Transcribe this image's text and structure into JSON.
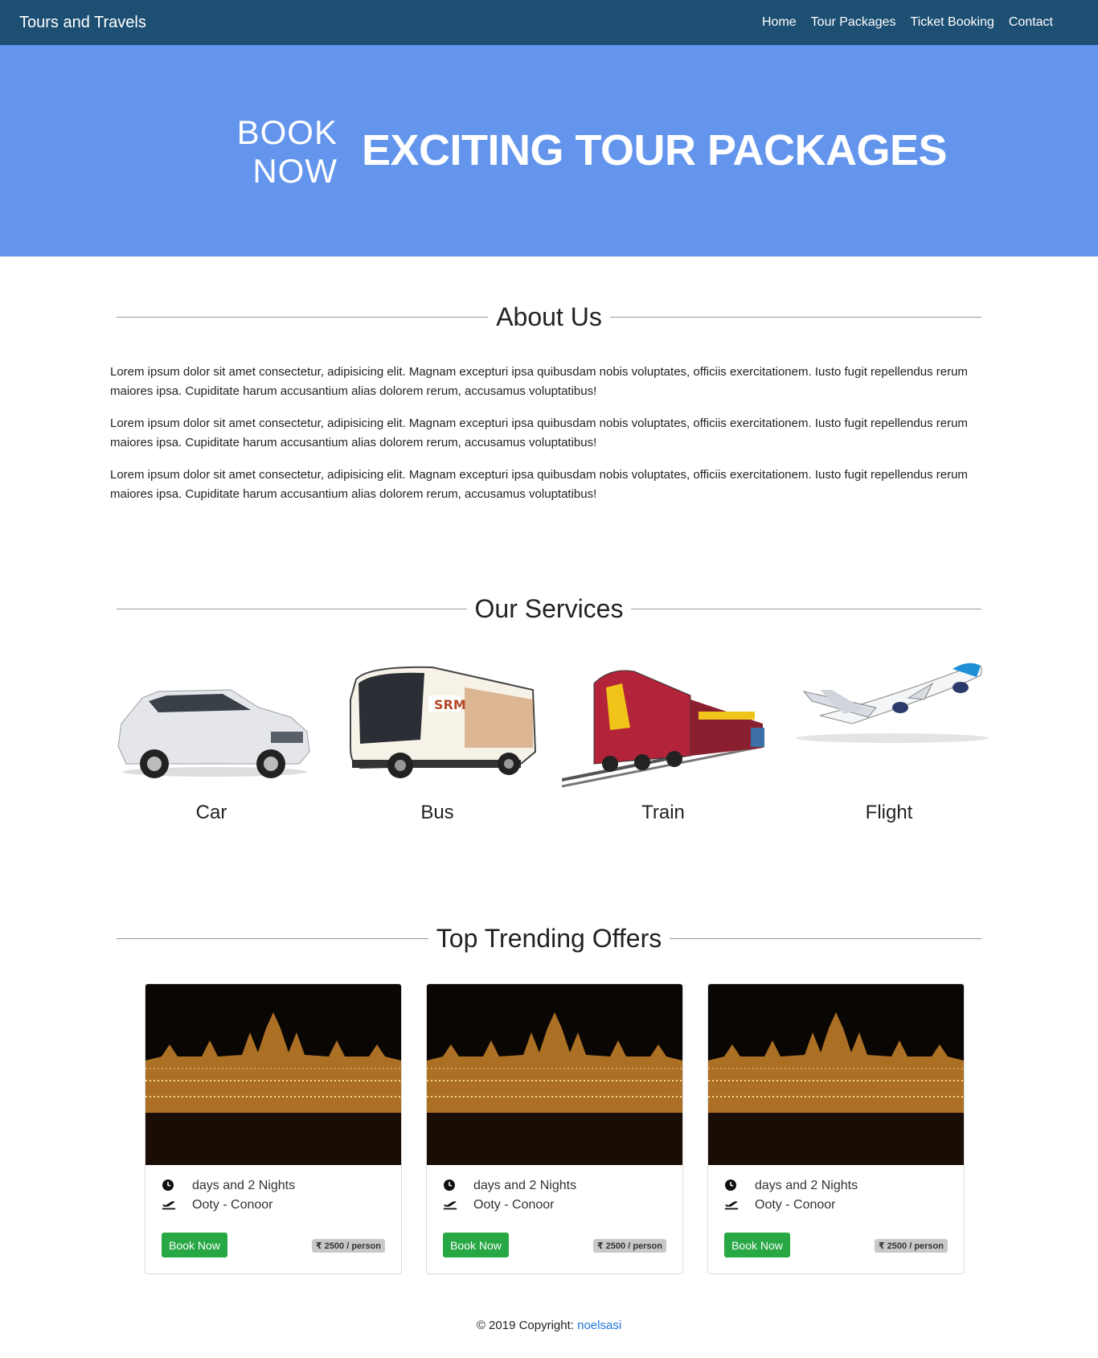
{
  "navbar": {
    "brand": "Tours and Travels",
    "links": [
      "Home",
      "Tour Packages",
      "Ticket Booking",
      "Contact"
    ]
  },
  "hero": {
    "small_line1": "BOOK",
    "small_line2": "NOW",
    "big": "EXCITING TOUR PACKAGES"
  },
  "about": {
    "heading": "About Us",
    "paragraphs": [
      "Lorem ipsum dolor sit amet consectetur, adipisicing elit. Magnam excepturi ipsa quibusdam nobis voluptates, officiis exercitationem. Iusto fugit repellendus rerum maiores ipsa. Cupiditate harum accusantium alias dolorem rerum, accusamus voluptatibus!",
      "Lorem ipsum dolor sit amet consectetur, adipisicing elit. Magnam excepturi ipsa quibusdam nobis voluptates, officiis exercitationem. Iusto fugit repellendus rerum maiores ipsa. Cupiditate harum accusantium alias dolorem rerum, accusamus voluptatibus!",
      "Lorem ipsum dolor sit amet consectetur, adipisicing elit. Magnam excepturi ipsa quibusdam nobis voluptates, officiis exercitationem. Iusto fugit repellendus rerum maiores ipsa. Cupiditate harum accusantium alias dolorem rerum, accusamus voluptatibus!"
    ]
  },
  "services": {
    "heading": "Our Services",
    "items": [
      {
        "label": "Car",
        "icon": "car-image"
      },
      {
        "label": "Bus",
        "icon": "bus-image"
      },
      {
        "label": "Train",
        "icon": "train-image"
      },
      {
        "label": "Flight",
        "icon": "flight-image"
      }
    ]
  },
  "offers": {
    "heading": "Top Trending Offers",
    "cards": [
      {
        "duration": "days and 2 Nights",
        "route": "Ooty - Conoor",
        "button": "Book Now",
        "price": "₹ 2500 / person"
      },
      {
        "duration": "days and 2 Nights",
        "route": "Ooty - Conoor",
        "button": "Book Now",
        "price": "₹ 2500 / person"
      },
      {
        "duration": "days and 2 Nights",
        "route": "Ooty - Conoor",
        "button": "Book Now",
        "price": "₹ 2500 / person"
      }
    ]
  },
  "footer": {
    "text": "© 2019 Copyright: ",
    "link": "noelsasi"
  },
  "colors": {
    "navbar": "#1d4f73",
    "hero": "#6495ed",
    "button": "#28a745",
    "link": "#1e73d9"
  }
}
